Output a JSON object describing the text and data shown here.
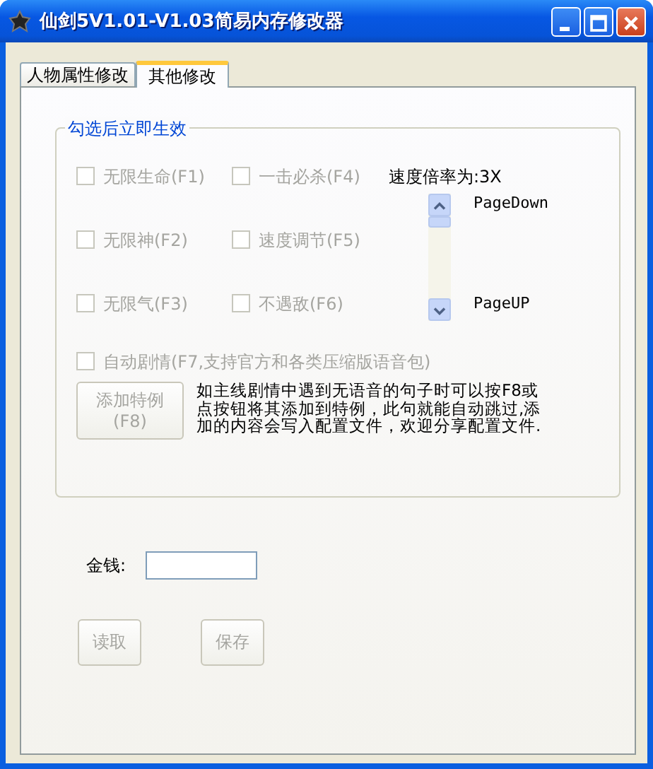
{
  "window": {
    "title": "仙剑5V1.01-V1.03简易内存修改器"
  },
  "tabs": [
    {
      "label": "人物属性修改",
      "selected": false
    },
    {
      "label": "其他修改",
      "selected": true
    }
  ],
  "group": {
    "title": "勾选后立即生效",
    "checkboxes": [
      {
        "label": "无限生命(F1)",
        "checked": false,
        "disabled": true
      },
      {
        "label": "一击必杀(F4)",
        "checked": false,
        "disabled": true
      },
      {
        "label": "无限神(F2)",
        "checked": false,
        "disabled": true
      },
      {
        "label": "速度调节(F5)",
        "checked": false,
        "disabled": true
      },
      {
        "label": "无限气(F3)",
        "checked": false,
        "disabled": true
      },
      {
        "label": "不遇敌(F6)",
        "checked": false,
        "disabled": true
      }
    ],
    "speed": {
      "label": "速度倍率为:3X",
      "top_label": "PageDown",
      "bottom_label": "PageUP"
    },
    "auto_story": {
      "label": "自动剧情(F7,支持官方和各类压缩版语音包)",
      "checked": false,
      "disabled": true
    },
    "add_button": {
      "label": "添加特例\n(F8)",
      "disabled": true
    },
    "note": "如主线剧情中遇到无语音的句子时可以按F8或点按钮将其添加到特例，此句就能自动跳过,添加的内容会写入配置文件，欢迎分享配置文件."
  },
  "money": {
    "label": "金钱:"
  },
  "buttons": [
    {
      "label": "读取",
      "disabled": true
    },
    {
      "label": "保存",
      "disabled": true
    }
  ]
}
